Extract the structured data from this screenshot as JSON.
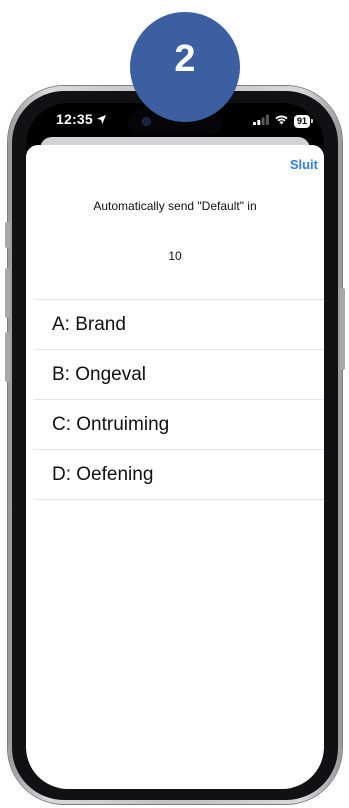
{
  "step_badge": "2",
  "status_bar": {
    "time": "12:35",
    "battery": "91"
  },
  "sheet": {
    "close_label": "Sluit",
    "auto_message": "Automatically send \"Default\" in",
    "countdown": "10",
    "options": [
      {
        "label": "A: Brand"
      },
      {
        "label": "B: Ongeval"
      },
      {
        "label": "C: Ontruiming"
      },
      {
        "label": "D: Oefening"
      }
    ]
  },
  "colors": {
    "accent": "#2f7fe6",
    "badge": "#3b5fa1"
  },
  "icons": [
    "location-arrow-icon",
    "signal-icon",
    "wifi-icon",
    "battery-icon"
  ]
}
